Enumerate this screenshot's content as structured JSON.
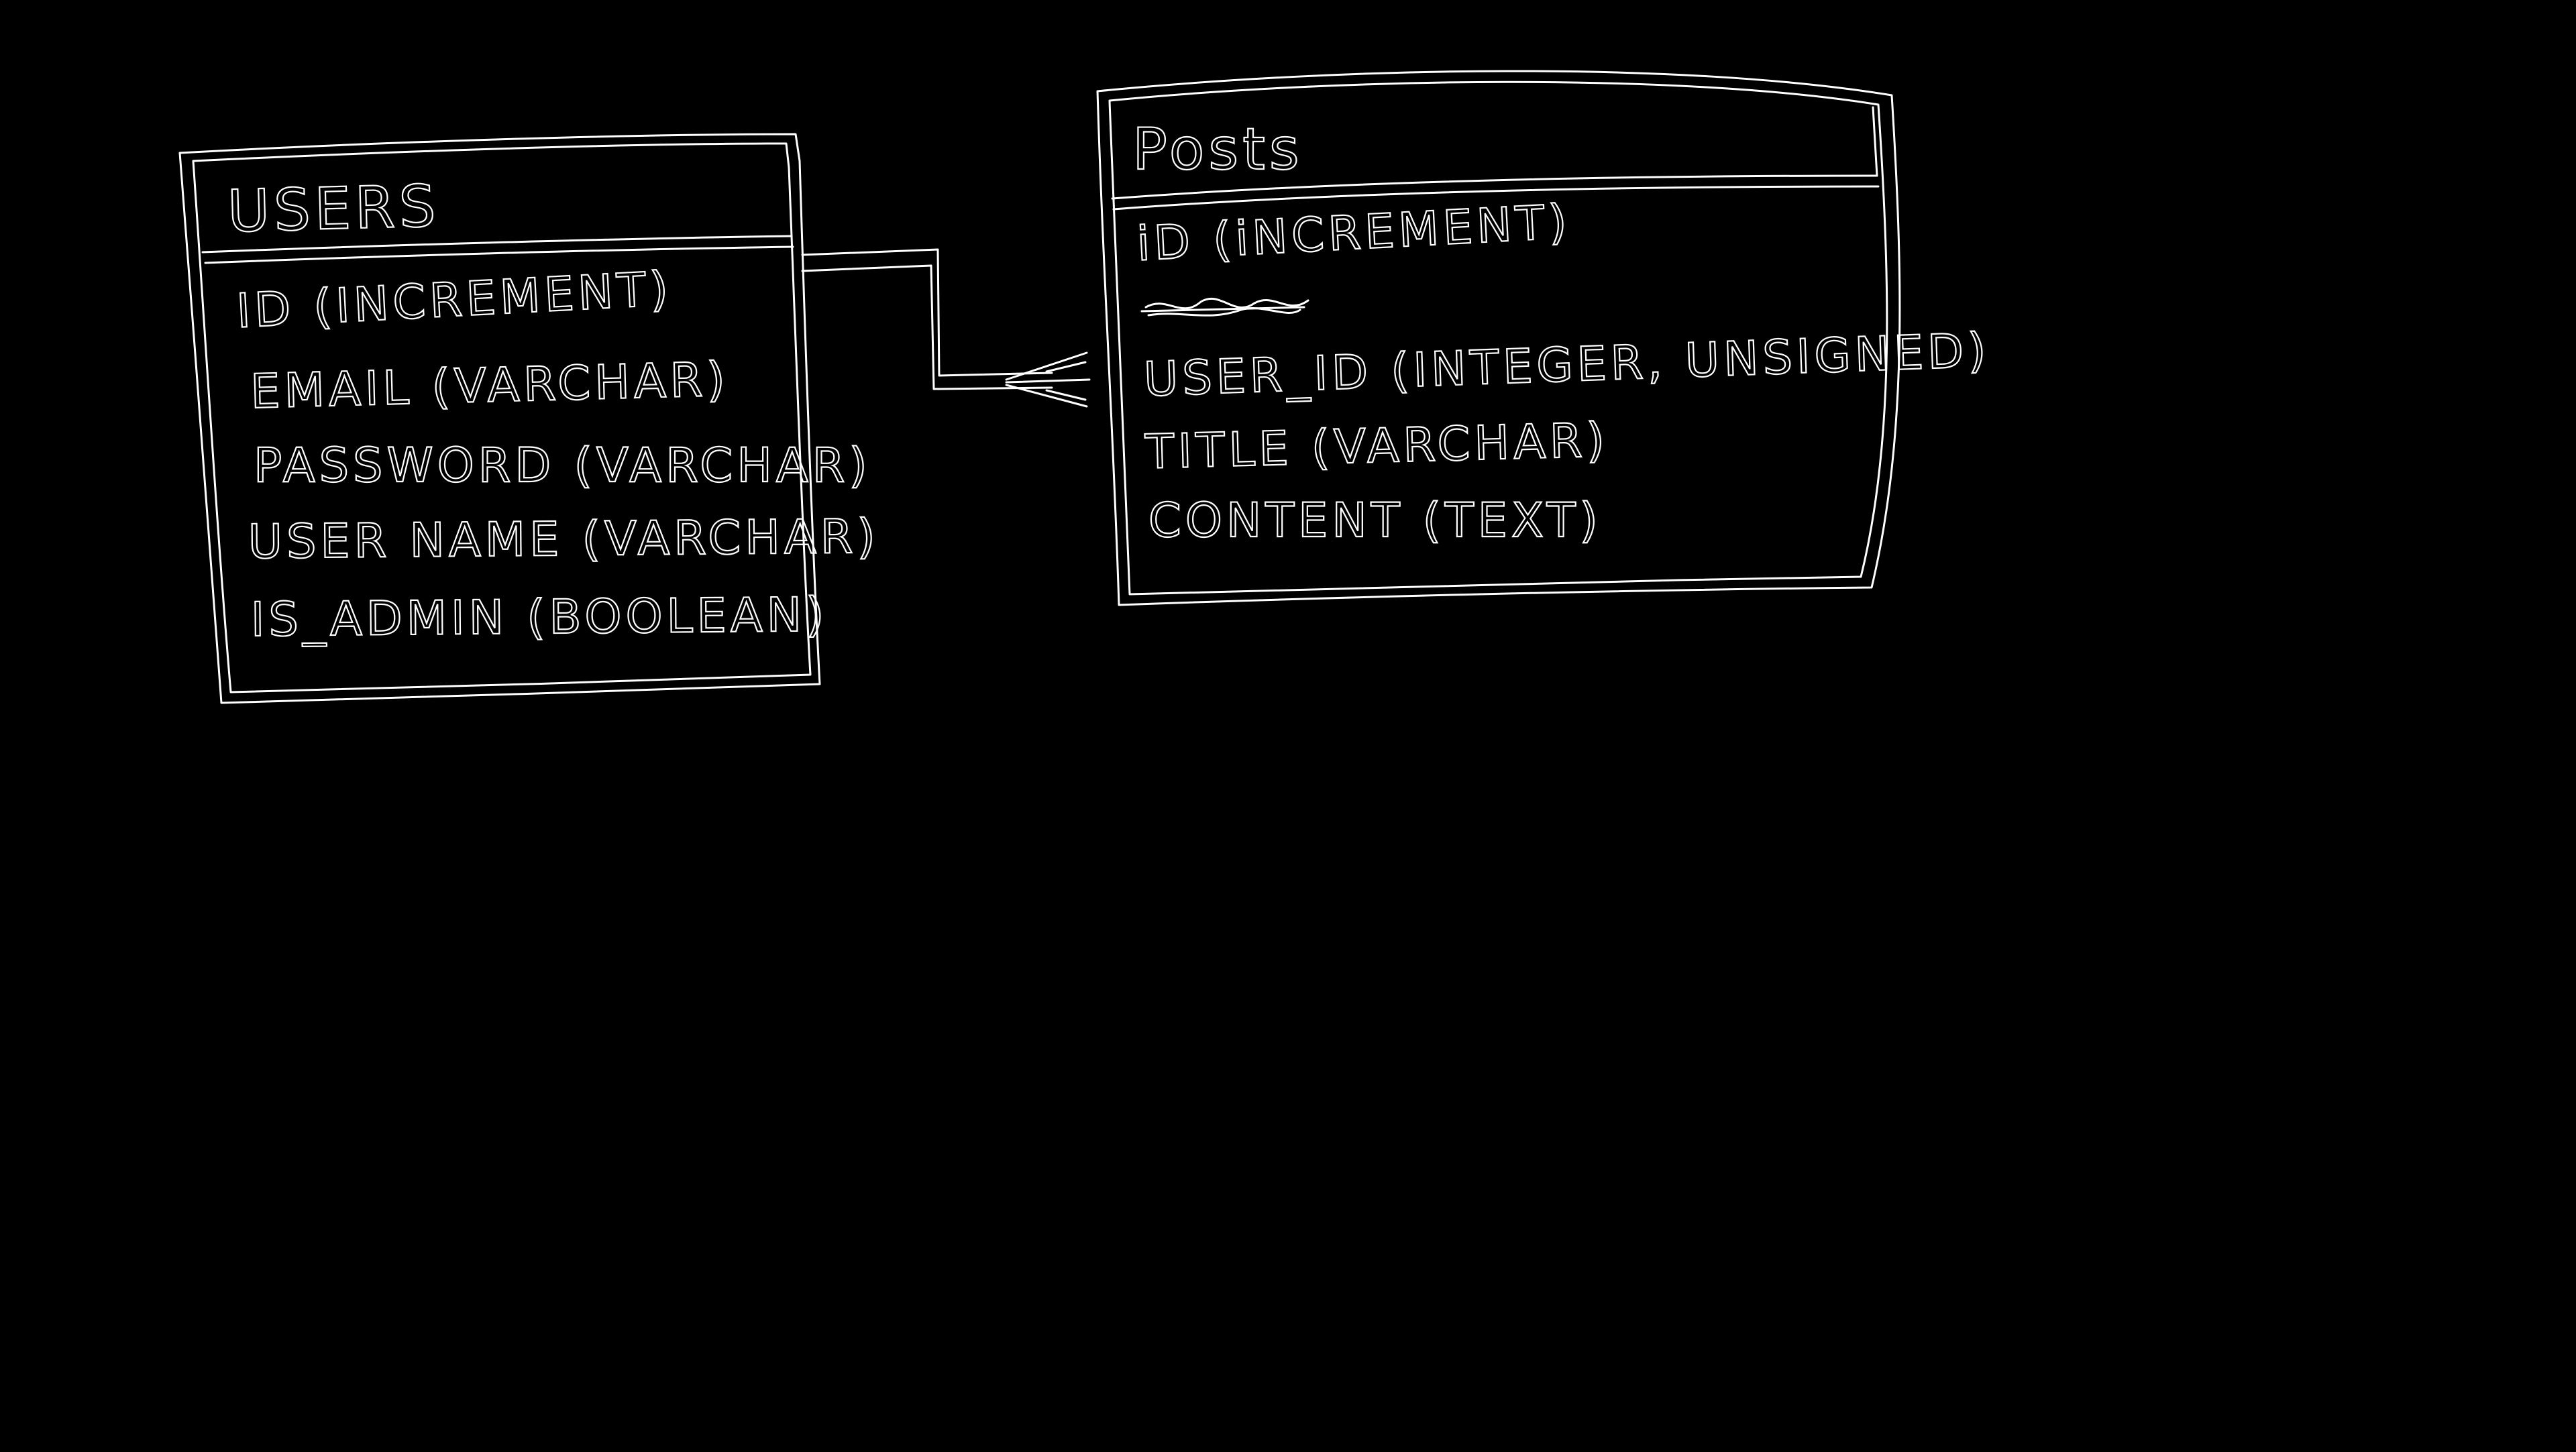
{
  "diagram": {
    "background": "#000000",
    "stroke_color": "#ffffff",
    "tables": [
      {
        "id": "users",
        "title": "USERS",
        "fields": [
          "ID (INCREMENT)",
          "EMAIL (VARCHAR)",
          "PASSWORD (VARCHAR)",
          "USER NAME (VARCHAR)",
          "IS_ADMIN (BOOLEAN)"
        ]
      },
      {
        "id": "posts",
        "title": "Posts",
        "fields": [
          "iD (iNCREMENT)",
          "USER_ID (INTEGER, UNSIGNED)",
          "TITLE (VARCHAR)",
          "CONTENT (TEXT)"
        ],
        "crossed_out_field": true
      }
    ],
    "relationship": {
      "from": "users",
      "to": "posts",
      "cardinality": "one-to-many"
    }
  }
}
